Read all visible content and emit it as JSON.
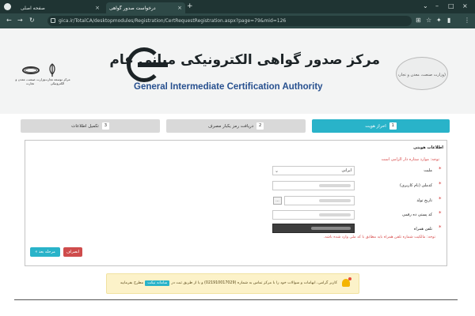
{
  "browser": {
    "tabs": [
      {
        "label": "صفحه اصلی",
        "close": "×"
      },
      {
        "label": "درخواست صدور گواهی",
        "close": "×"
      }
    ],
    "new_tab": "+",
    "url": "gica.ir/TotalCA/desktopmodules/Registration/CertRequestRegistration.aspx?page=79&mid=126"
  },
  "header": {
    "title_fa": "مرکز صدور گواهی الکترونیکی میانی عام",
    "title_en": "General Intermediate Certification Authority",
    "seal_text": "(وزارت صنعت، معدن و تجارت)"
  },
  "steps": [
    {
      "num": "1",
      "label": "احراز هویت",
      "active": true
    },
    {
      "num": "2",
      "label": "دریافت رمز یکبار مصرف",
      "active": false
    },
    {
      "num": "3",
      "label": "تکمیل اطلاعات",
      "active": false
    }
  ],
  "form": {
    "legend": "اطلاعات هویتی",
    "note": "توجه: موارد ستاره دار الزامی است",
    "fields": [
      {
        "label": "ملیت",
        "value": "ایرانی"
      },
      {
        "label": "کدملی (نام کاربری)",
        "value": ""
      },
      {
        "label": "تاریخ تولد",
        "value": ""
      },
      {
        "label": "کد پستی ده رقمی",
        "value": ""
      },
      {
        "label": "تلفن همراه",
        "value": ""
      }
    ],
    "calendar_btn": "...",
    "mobile_note": "توجه: مالکیت شماره تلفن همراه باید مطابق با کد ملی وارد شده باشد.",
    "next_button": "مرحله بعد »",
    "cancel_button": "انصراف"
  },
  "notification": {
    "text": "کاربر گرامی، ابهامات و سوالات خود را با مرکز تماس به شماره (021910017029) و یا از طریق ثبت در",
    "link": "سامانه تیکت",
    "suffix": "مطرح بفرمایید"
  },
  "colors": {
    "accent": "#29b3c9",
    "danger": "#cf4c4c",
    "title_en": "#27508f"
  }
}
